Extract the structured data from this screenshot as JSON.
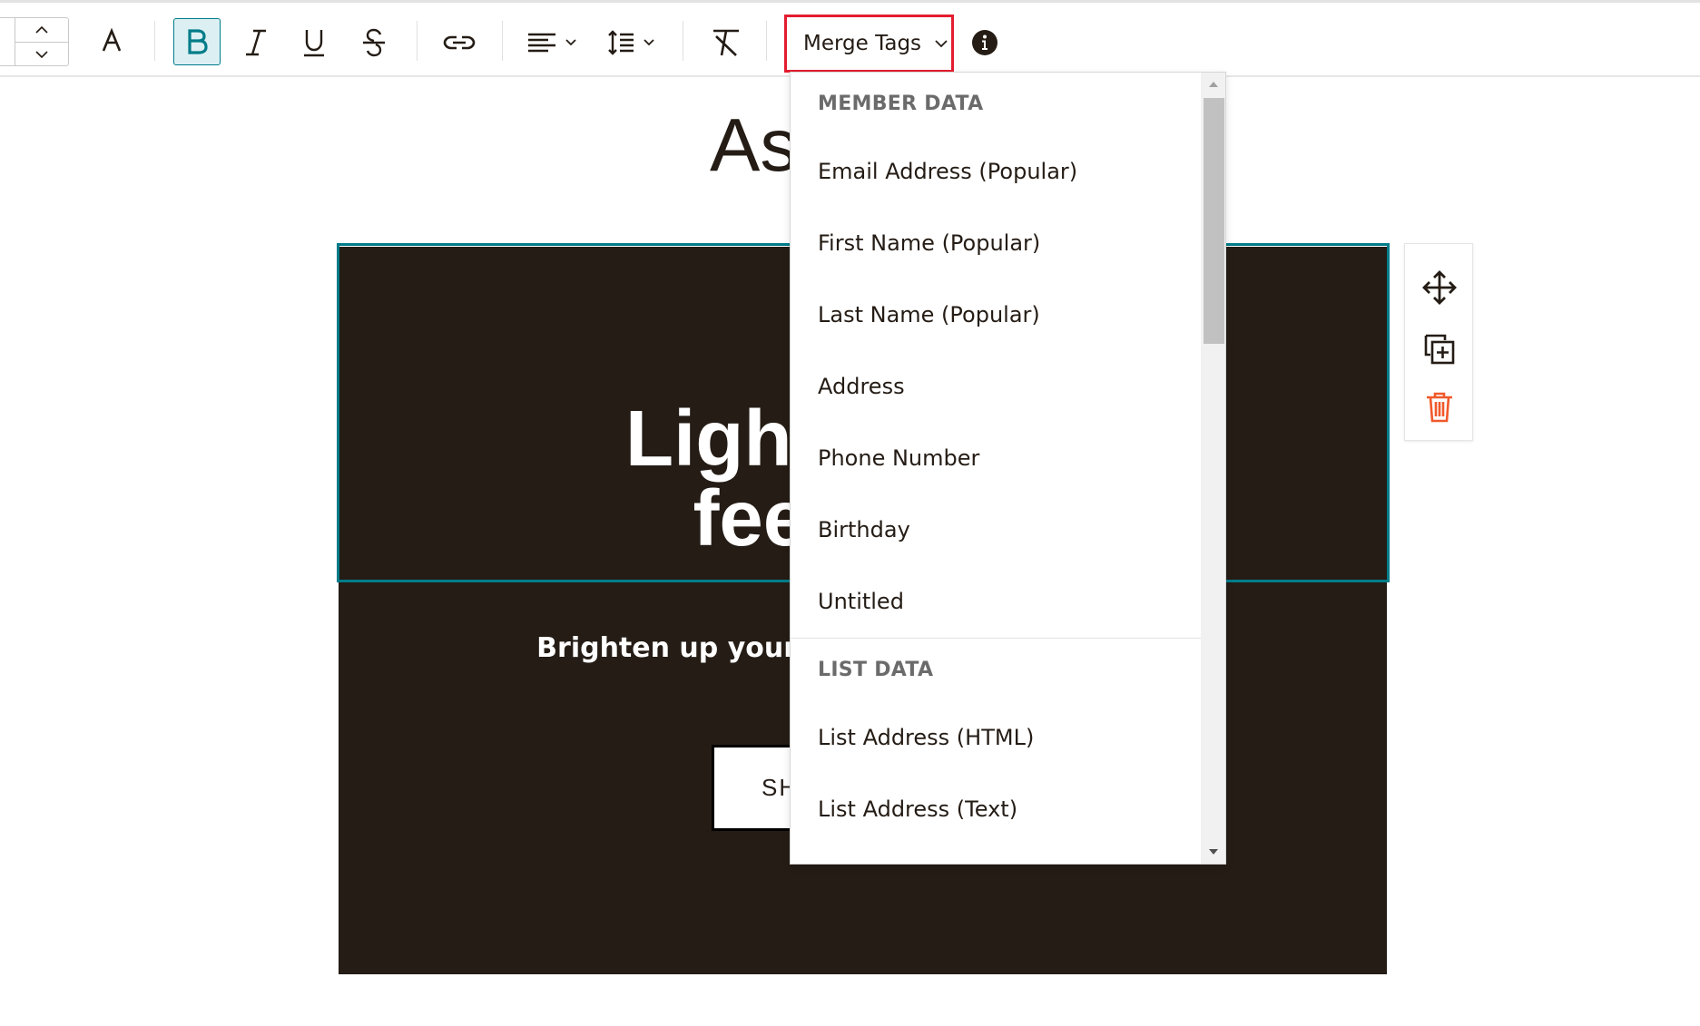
{
  "toolbar": {
    "merge_tags_label": "Merge Tags",
    "icons": [
      "chevron-up-icon",
      "chevron-down-icon",
      "text-color-icon",
      "bold-icon",
      "italic-icon",
      "underline-icon",
      "strikethrough-icon",
      "link-icon",
      "align-left-icon",
      "line-height-icon",
      "clear-format-icon",
      "info-icon"
    ]
  },
  "canvas": {
    "headline_partial": "As",
    "hero_title_line1": "Lighting",
    "hero_title_line2": "feeli",
    "hero_subtitle_partial": "Brighten up your h",
    "button_partial": "SH"
  },
  "dropdown": {
    "sections": [
      {
        "heading": "MEMBER DATA",
        "items": [
          "Email Address (Popular)",
          "First Name (Popular)",
          "Last Name (Popular)",
          "Address",
          "Phone Number",
          "Birthday",
          "Untitled"
        ]
      },
      {
        "heading": "LIST DATA",
        "items": [
          "List Address (HTML)",
          "List Address (Text)"
        ]
      }
    ]
  },
  "colors": {
    "accent_teal": "#007c89",
    "highlight_red": "#e31c2f",
    "dark_block": "#241c15",
    "delete_orange": "#f0592b"
  }
}
